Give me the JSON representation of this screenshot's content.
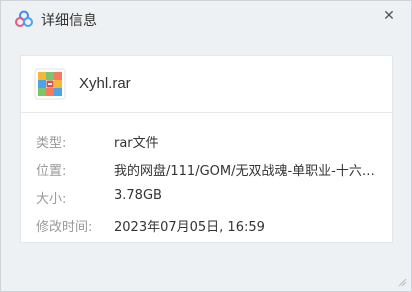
{
  "window": {
    "title": "详细信息",
    "close_glyph": "✕"
  },
  "file": {
    "name": "Xyhl.rar",
    "icon": "rar-archive-icon"
  },
  "details": [
    {
      "label": "类型:",
      "value": "rar文件"
    },
    {
      "label": "位置:",
      "value": "我的网盘/111/GOM/无双战魂-单职业-十六大陆..."
    },
    {
      "label": "大小:",
      "value": "3.78GB"
    },
    {
      "label": "修改时间:",
      "value": "2023年07月05日, 16:59"
    }
  ],
  "colors": {
    "background": "#eef1f4",
    "card": "#ffffff",
    "label": "#999999",
    "text": "#333333"
  }
}
